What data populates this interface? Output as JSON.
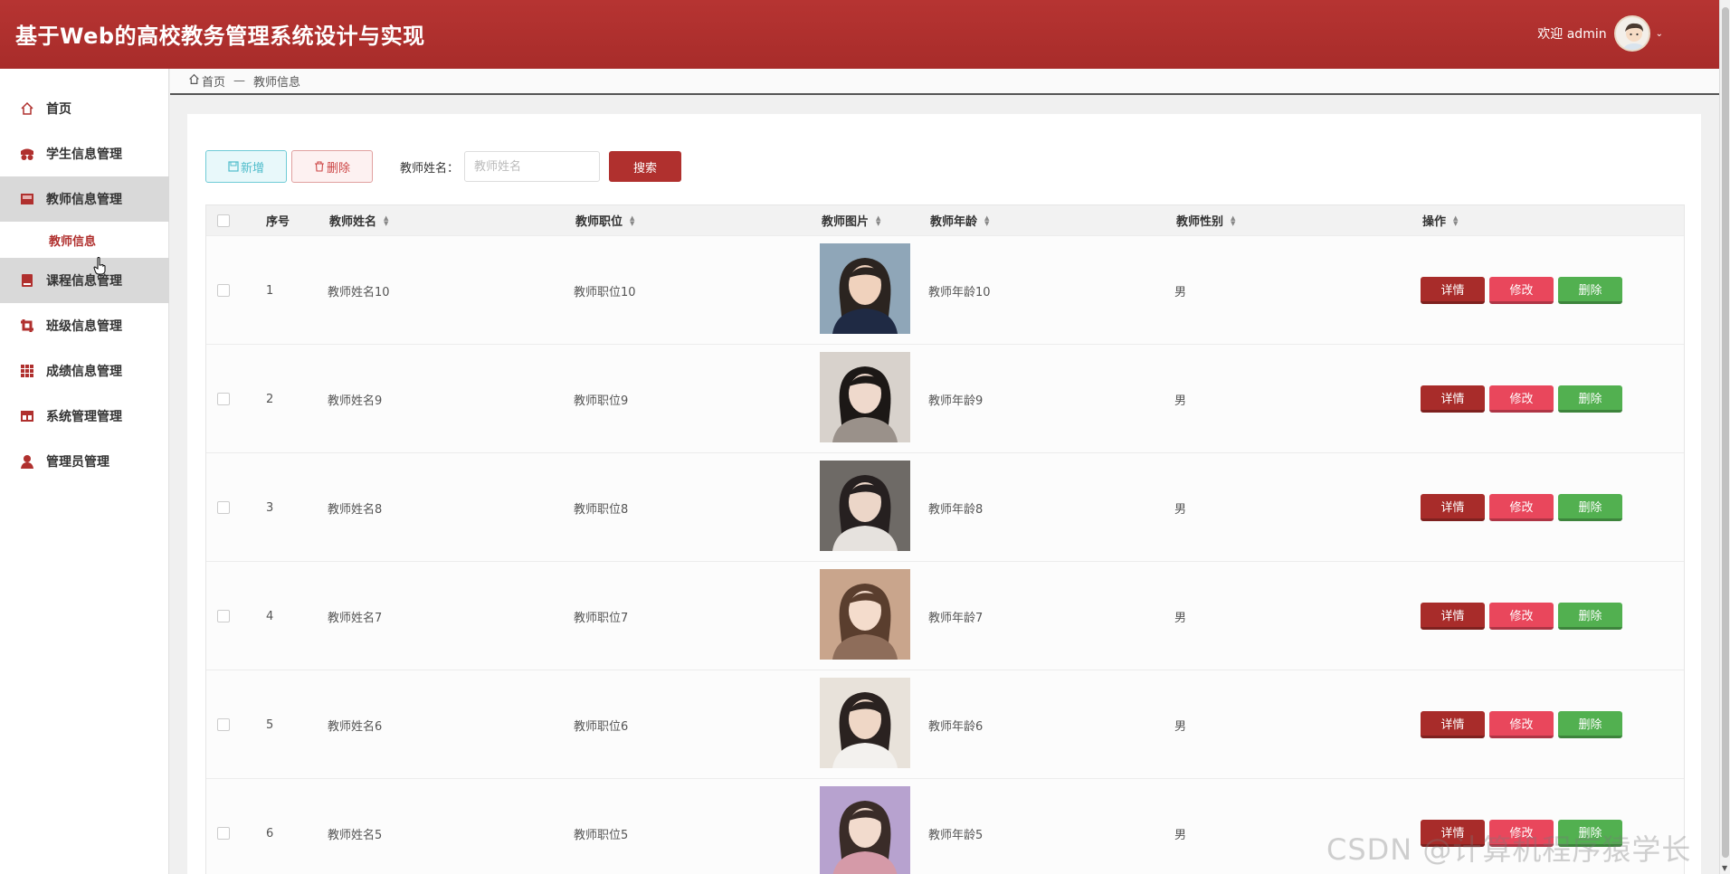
{
  "header": {
    "title": "基于Web的高校教务管理系统设计与实现",
    "welcome": "欢迎 admin"
  },
  "sidebar": {
    "items": [
      {
        "label": "首页",
        "icon": "home-icon"
      },
      {
        "label": "学生信息管理",
        "icon": "student-icon"
      },
      {
        "label": "教师信息管理",
        "icon": "teacher-icon"
      },
      {
        "label": "课程信息管理",
        "icon": "course-icon"
      },
      {
        "label": "班级信息管理",
        "icon": "class-icon"
      },
      {
        "label": "成绩信息管理",
        "icon": "grade-icon"
      },
      {
        "label": "系统管理管理",
        "icon": "system-icon"
      },
      {
        "label": "管理员管理",
        "icon": "admin-icon"
      }
    ],
    "sub_items": [
      {
        "label": "教师信息"
      }
    ]
  },
  "breadcrumb": {
    "home": "首页",
    "separator": "—",
    "current": "教师信息"
  },
  "toolbar": {
    "add_label": "新增",
    "delete_label": "删除",
    "search_label": "教师姓名：",
    "search_placeholder": "教师姓名",
    "search_button": "搜索"
  },
  "table": {
    "columns": [
      "序号",
      "教师姓名",
      "教师职位",
      "教师图片",
      "教师年龄",
      "教师性别",
      "操作"
    ],
    "actions": {
      "detail": "详情",
      "edit": "修改",
      "remove": "删除"
    },
    "rows": [
      {
        "index": "1",
        "name": "教师姓名10",
        "position": "教师职位10",
        "age": "教师年龄10",
        "gender": "男"
      },
      {
        "index": "2",
        "name": "教师姓名9",
        "position": "教师职位9",
        "age": "教师年龄9",
        "gender": "男"
      },
      {
        "index": "3",
        "name": "教师姓名8",
        "position": "教师职位8",
        "age": "教师年龄8",
        "gender": "男"
      },
      {
        "index": "4",
        "name": "教师姓名7",
        "position": "教师职位7",
        "age": "教师年龄7",
        "gender": "男"
      },
      {
        "index": "5",
        "name": "教师姓名6",
        "position": "教师职位6",
        "age": "教师年龄6",
        "gender": "男"
      },
      {
        "index": "6",
        "name": "教师姓名5",
        "position": "教师职位5",
        "age": "教师年龄5",
        "gender": "男"
      }
    ]
  },
  "watermark": "CSDN @计算机程序猿学长",
  "colors": {
    "primary": "#b0302e",
    "edit": "#e9475c",
    "remove": "#52b050",
    "add": "#4fbccb"
  }
}
